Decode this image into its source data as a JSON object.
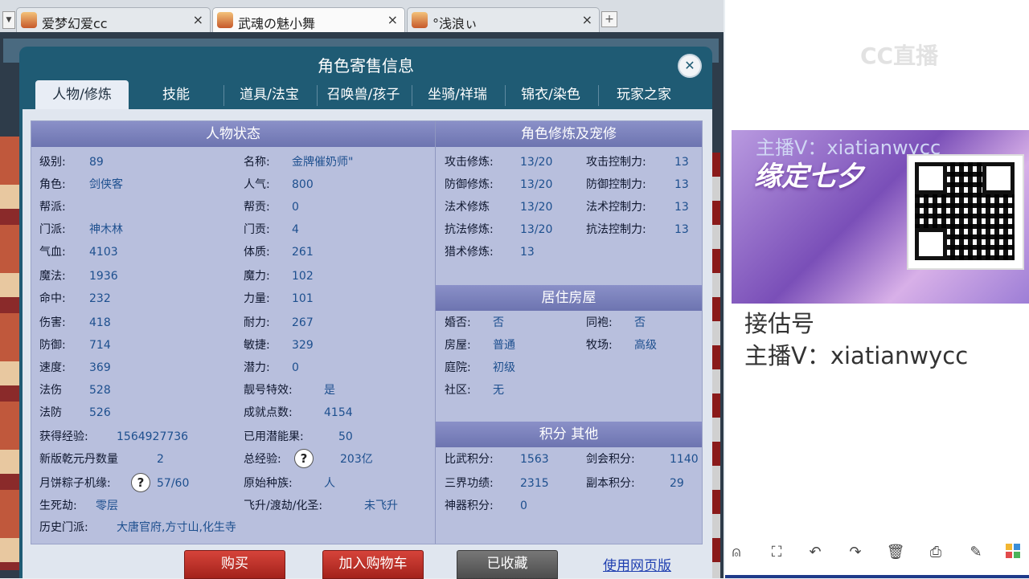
{
  "browser": {
    "tabs": [
      {
        "label": "爱梦幻爱cc",
        "active": false
      },
      {
        "label": "武魂の魅小舞",
        "active": true
      },
      {
        "label": "°浅浪ぃ",
        "active": false
      }
    ],
    "close_glyph": "×",
    "new_tab_glyph": "+"
  },
  "modal": {
    "title": "角色寄售信息",
    "close_glyph": "✕",
    "tabs": [
      "人物/修炼",
      "技能",
      "道具/法宝",
      "召唤兽/孩子",
      "坐骑/祥瑞",
      "锦衣/染色",
      "玩家之家"
    ],
    "active_tab": "人物/修炼"
  },
  "char_status": {
    "title": "人物状态",
    "left": [
      {
        "k": "级别:",
        "v": "89"
      },
      {
        "k": "角色:",
        "v": "剑侠客"
      },
      {
        "k": "帮派:",
        "v": ""
      },
      {
        "k": "门派:",
        "v": "神木林"
      },
      {
        "k": "气血:",
        "v": "4103"
      },
      {
        "k": "魔法:",
        "v": "1936"
      },
      {
        "k": "命中:",
        "v": "232"
      },
      {
        "k": "伤害:",
        "v": "418"
      },
      {
        "k": "防御:",
        "v": "714"
      },
      {
        "k": "速度:",
        "v": "369"
      },
      {
        "k": "法伤",
        "v": "528"
      },
      {
        "k": "法防",
        "v": "526"
      }
    ],
    "right": [
      {
        "k": "名称:",
        "v": "金牌催奶师\""
      },
      {
        "k": "人气:",
        "v": "800"
      },
      {
        "k": "帮贡:",
        "v": "0"
      },
      {
        "k": "门贡:",
        "v": "4"
      },
      {
        "k": "体质:",
        "v": "261"
      },
      {
        "k": "魔力:",
        "v": "102"
      },
      {
        "k": "力量:",
        "v": "101"
      },
      {
        "k": "耐力:",
        "v": "267"
      },
      {
        "k": "敏捷:",
        "v": "329"
      },
      {
        "k": "潜力:",
        "v": "0"
      },
      {
        "k": "靓号特效:",
        "v": "是"
      },
      {
        "k": "成就点数:",
        "v": "4154"
      }
    ],
    "extra": {
      "exp_k": "获得经验:",
      "exp_v": "1564927736",
      "potential_k": "已用潜能果:",
      "potential_v": "50",
      "qianyuan_k": "新版乾元丹数量",
      "qianyuan_v": "2",
      "total_exp_k": "总经验:",
      "total_exp_v": "203亿",
      "mooncake_k": "月饼粽子机缘:",
      "mooncake_v": "57/60",
      "race_k": "原始种族:",
      "race_v": "人",
      "life_k": "生死劫:",
      "life_v": "零层",
      "ascend_k": "飞升/渡劫/化圣:",
      "ascend_v": "未飞升",
      "history_k": "历史门派:",
      "history_v": "大唐官府,方寸山,化生寺",
      "help_glyph": "?"
    }
  },
  "cultivation": {
    "title": "角色修炼及宠修",
    "rows": [
      {
        "k1": "攻击修炼:",
        "v1": "13/20",
        "k2": "攻击控制力:",
        "v2": "13"
      },
      {
        "k1": "防御修炼:",
        "v1": "13/20",
        "k2": "防御控制力:",
        "v2": "13"
      },
      {
        "k1": "法术修炼",
        "v1": "13/20",
        "k2": "法术控制力:",
        "v2": "13"
      },
      {
        "k1": "抗法修炼:",
        "v1": "13/20",
        "k2": "抗法控制力:",
        "v2": "13"
      },
      {
        "k1": "猎术修炼:",
        "v1": "13",
        "k2": "",
        "v2": ""
      }
    ]
  },
  "housing": {
    "title": "居住房屋",
    "rows": [
      {
        "k1": "婚否:",
        "v1": "否",
        "k2": "同袍:",
        "v2": "否"
      },
      {
        "k1": "房屋:",
        "v1": "普通",
        "k2": "牧场:",
        "v2": "高级"
      },
      {
        "k1": "庭院:",
        "v1": "初级",
        "k2": "",
        "v2": ""
      },
      {
        "k1": "社区:",
        "v1": "无",
        "k2": "",
        "v2": ""
      }
    ]
  },
  "points": {
    "title": "积分 其他",
    "rows": [
      {
        "k1": "比武积分:",
        "v1": "1563",
        "k2": "剑会积分:",
        "v2": "1140"
      },
      {
        "k1": "三界功绩:",
        "v1": "2315",
        "k2": "副本积分:",
        "v2": "29"
      },
      {
        "k1": "神器积分:",
        "v1": "0",
        "k2": "",
        "v2": ""
      }
    ]
  },
  "actions": {
    "buy": "购买",
    "cart": "加入购物车",
    "saved": "已收藏",
    "web": "使用网页版"
  },
  "stream": {
    "logo": "CC直播",
    "banner_title": "缘定七夕",
    "banner_overlay": "主播V：xiatianwycc",
    "line1": "接估号",
    "line2": "主播V：xiatianwycc",
    "toolbar_icons": [
      "mouse-icon",
      "fullscreen-icon",
      "undo-icon",
      "redo-icon",
      "delete-icon",
      "print-icon",
      "edit-icon",
      "grid-icon"
    ]
  }
}
